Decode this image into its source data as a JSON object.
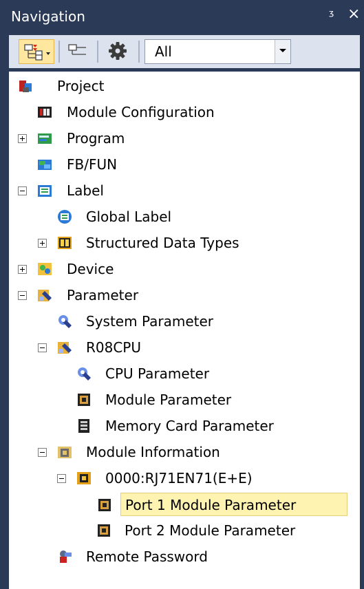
{
  "panel": {
    "title": "Navigation",
    "pin_glyph": "ᶾ",
    "close_glyph": "×"
  },
  "toolbar": {
    "buttons": [
      {
        "name": "tree-view-dropdown",
        "icon": "tree-view-icon"
      },
      {
        "name": "tree-toggle",
        "icon": "tree-branch-icon"
      },
      {
        "name": "settings",
        "icon": "gear-icon"
      }
    ],
    "filter": {
      "value": "All"
    }
  },
  "tree": {
    "items": [
      {
        "label": "Project",
        "icon": "project-icon",
        "expander": null
      },
      {
        "label": "Module Configuration",
        "icon": "module-configuration-icon",
        "expander": null
      },
      {
        "label": "Program",
        "icon": "program-icon",
        "expander": "collapsed"
      },
      {
        "label": "FB/FUN",
        "icon": "fb-fun-icon",
        "expander": null
      },
      {
        "label": "Label",
        "icon": "label-icon",
        "expander": "expanded"
      },
      {
        "label": "Global Label",
        "icon": "global-label-icon",
        "expander": null
      },
      {
        "label": "Structured Data Types",
        "icon": "structured-data-icon",
        "expander": "collapsed"
      },
      {
        "label": "Device",
        "icon": "device-icon",
        "expander": "collapsed"
      },
      {
        "label": "Parameter",
        "icon": "parameter-icon",
        "expander": "expanded"
      },
      {
        "label": "System Parameter",
        "icon": "system-parameter-icon",
        "expander": null
      },
      {
        "label": "R08CPU",
        "icon": "cpu-folder-icon",
        "expander": "expanded"
      },
      {
        "label": "CPU Parameter",
        "icon": "cpu-parameter-icon",
        "expander": null
      },
      {
        "label": "Module Parameter",
        "icon": "module-parameter-icon",
        "expander": null
      },
      {
        "label": "Memory Card Parameter",
        "icon": "memory-card-icon",
        "expander": null
      },
      {
        "label": "Module Information",
        "icon": "module-information-icon",
        "expander": "expanded"
      },
      {
        "label": "0000:RJ71EN71(E+E)",
        "icon": "ethernet-module-icon",
        "expander": "expanded"
      },
      {
        "label": "Port 1 Module Parameter",
        "icon": "port-parameter-icon",
        "expander": null,
        "selected": true
      },
      {
        "label": "Port 2 Module Parameter",
        "icon": "port-parameter-icon",
        "expander": null
      },
      {
        "label": "Remote Password",
        "icon": "remote-password-icon",
        "expander": null
      }
    ]
  },
  "colors": {
    "frame": "#2b3a56",
    "toolbar": "#dde3ee",
    "selection": "#fff3b2"
  }
}
